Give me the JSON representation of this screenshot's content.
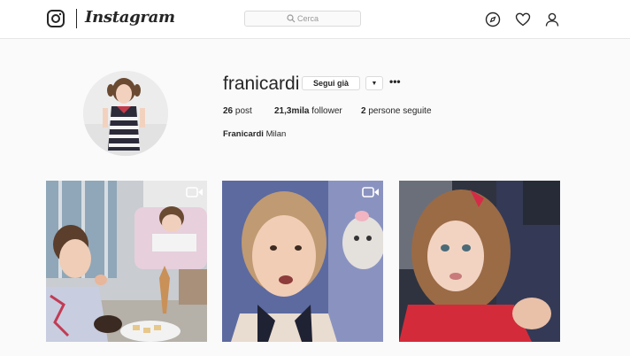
{
  "header": {
    "wordmark": "Instagram",
    "search_placeholder": "Cerca",
    "icons": [
      "instagram-logo-icon",
      "compass-icon",
      "heart-icon",
      "user-icon"
    ]
  },
  "profile": {
    "username": "franicardi",
    "follow_button": "Segui già",
    "dropdown_glyph": "▼",
    "more_glyph": "•••",
    "stats": {
      "posts_count": "26",
      "posts_label": "post",
      "followers_count": "21,3mila",
      "followers_label": "follower",
      "following_count": "2",
      "following_label": "persone seguite"
    },
    "bio_name": "Franicardi",
    "bio_text": "Milan"
  },
  "posts": [
    {
      "type": "video",
      "badge_icon": "video-camera-icon"
    },
    {
      "type": "video",
      "badge_icon": "video-camera-icon"
    },
    {
      "type": "photo"
    }
  ],
  "colors": {
    "background": "#fafafa",
    "text": "#262626",
    "border": "#dbdbdb"
  }
}
